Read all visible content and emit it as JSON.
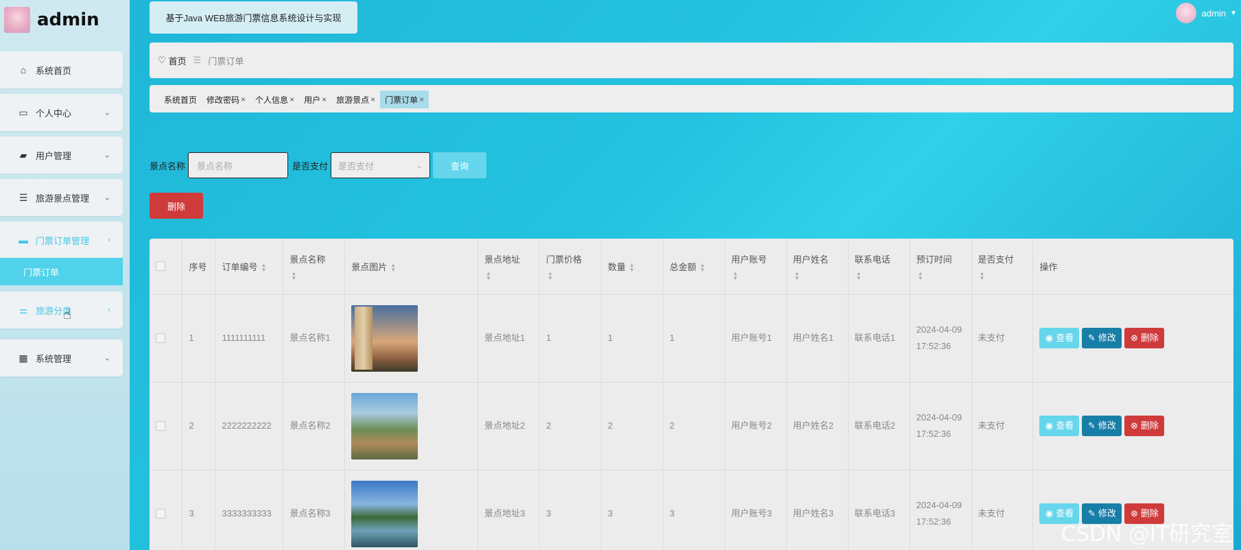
{
  "sidebar": {
    "brand": "admin",
    "items": [
      {
        "label": "系统首页",
        "icon": "home-icon",
        "glyph": "⌂",
        "arrow": ""
      },
      {
        "label": "个人中心",
        "icon": "card-icon",
        "glyph": "▭",
        "arrow": "⌄"
      },
      {
        "label": "用户管理",
        "icon": "wallet-icon",
        "glyph": "▰",
        "arrow": "⌄"
      },
      {
        "label": "旅游景点管理",
        "icon": "list-icon",
        "glyph": "☰",
        "arrow": "⌄"
      },
      {
        "label": "门票订单管理",
        "icon": "chat-icon",
        "glyph": "▬",
        "arrow": "‹"
      },
      {
        "label": "旅游分类",
        "icon": "sliders-icon",
        "glyph": "⚌",
        "arrow": "‹"
      },
      {
        "label": "系统管理",
        "icon": "grid-icon",
        "glyph": "▦",
        "arrow": "⌄"
      }
    ],
    "submenu_active": "门票订单"
  },
  "header": {
    "title": "基于Java WEB旅游门票信息系统设计与实现",
    "user": "admin"
  },
  "breadcrumb": {
    "home": "首页",
    "sep": "☰",
    "current": "门票订单"
  },
  "tabs": [
    {
      "label": "系统首页",
      "closable": false
    },
    {
      "label": "修改密码",
      "closable": true
    },
    {
      "label": "个人信息",
      "closable": true
    },
    {
      "label": "用户",
      "closable": true
    },
    {
      "label": "旅游景点",
      "closable": true
    },
    {
      "label": "门票订单",
      "closable": true,
      "active": true
    }
  ],
  "search": {
    "name_label": "景点名称",
    "name_placeholder": "景点名称",
    "pay_label": "是否支付",
    "pay_placeholder": "是否支付",
    "query_btn": "查询"
  },
  "delete_btn": "删除",
  "table": {
    "headers": [
      "序号",
      "订单编号",
      "景点名称",
      "景点图片",
      "景点地址",
      "门票价格",
      "数量",
      "总金额",
      "用户账号",
      "用户姓名",
      "联系电话",
      "预订时间",
      "是否支付",
      "操作"
    ],
    "rows": [
      {
        "idx": "1",
        "order": "1111111111",
        "name": "景点名称1",
        "addr": "景点地址1",
        "price": "1",
        "qty": "1",
        "total": "1",
        "account": "用户账号1",
        "uname": "用户姓名1",
        "phone": "联系电话1",
        "time": "2024-04-09 17:52:36",
        "paid": "未支付"
      },
      {
        "idx": "2",
        "order": "2222222222",
        "name": "景点名称2",
        "addr": "景点地址2",
        "price": "2",
        "qty": "2",
        "total": "2",
        "account": "用户账号2",
        "uname": "用户姓名2",
        "phone": "联系电话2",
        "time": "2024-04-09 17:52:36",
        "paid": "未支付"
      },
      {
        "idx": "3",
        "order": "3333333333",
        "name": "景点名称3",
        "addr": "景点地址3",
        "price": "3",
        "qty": "3",
        "total": "3",
        "account": "用户账号3",
        "uname": "用户姓名3",
        "phone": "联系电话3",
        "time": "2024-04-09 17:52:36",
        "paid": "未支付"
      }
    ],
    "actions": {
      "view": "查看",
      "edit": "修改",
      "del": "删除"
    }
  },
  "watermark": "CSDN @IT研究室"
}
